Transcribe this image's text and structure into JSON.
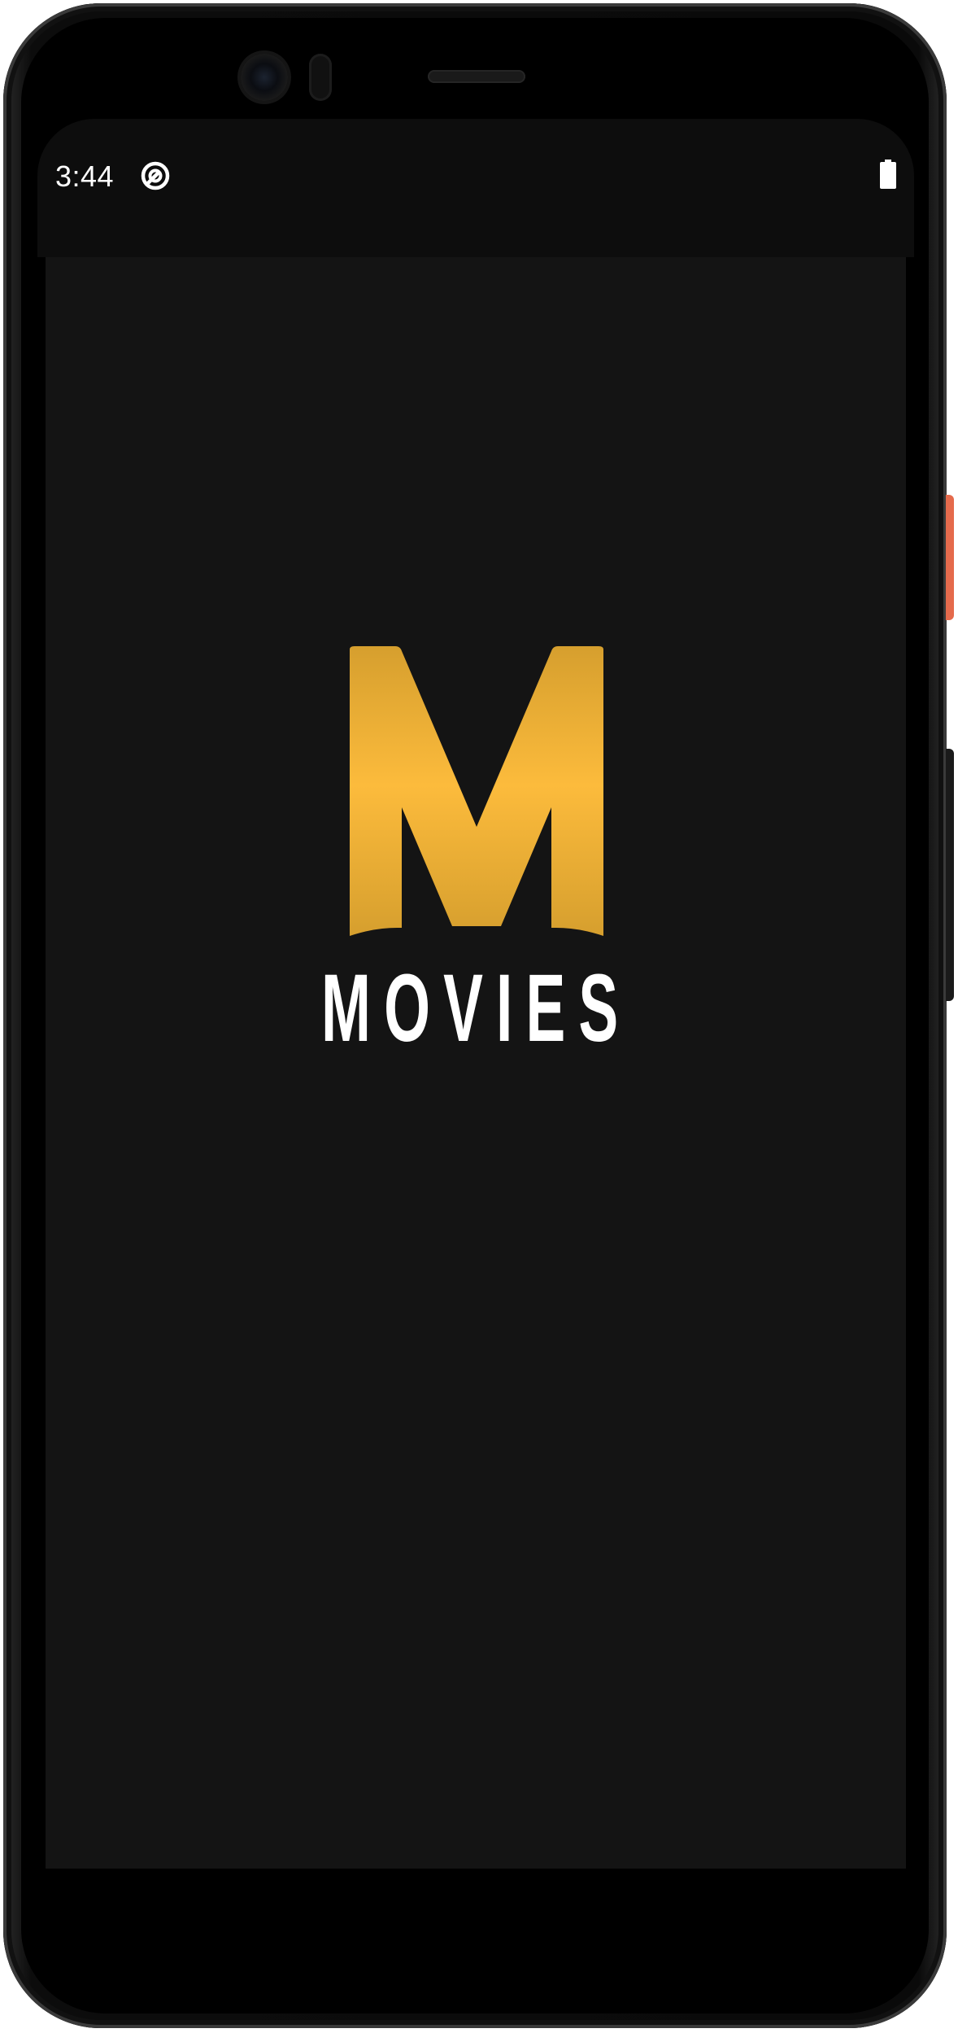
{
  "status_bar": {
    "time": "3:44",
    "app_icon": "notification-app-icon",
    "battery_icon": "battery-full-icon"
  },
  "splash": {
    "logo_icon": "m-logo-icon",
    "brand_text": "MOVIES"
  },
  "colors": {
    "background": "#141414",
    "logo_gold_light": "#FCBB3C",
    "logo_gold_dark": "#D69F2E",
    "text": "#FFFFFF"
  }
}
